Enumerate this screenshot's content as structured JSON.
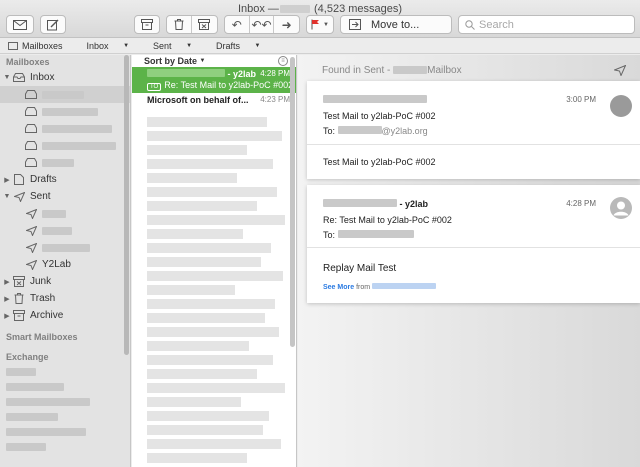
{
  "window": {
    "title": "Inbox",
    "count": "(4,523 messages)"
  },
  "toolbar": {
    "move_label": "Move to...",
    "search_placeholder": "Search"
  },
  "favorites": {
    "mailboxes": "Mailboxes",
    "inbox": "Inbox",
    "sent": "Sent",
    "drafts": "Drafts"
  },
  "sidebar": {
    "section_mailboxes": "Mailboxes",
    "inbox": "Inbox",
    "drafts": "Drafts",
    "sent": "Sent",
    "sent_child": "Y2Lab",
    "junk": "Junk",
    "trash": "Trash",
    "archive": "Archive",
    "section_smart": "Smart Mailboxes",
    "section_exchange": "Exchange"
  },
  "list": {
    "sort_label": "Sort by Date",
    "messages": [
      {
        "from": "- y2lab",
        "time": "4:28 PM",
        "badge": "TO",
        "subject": "Re: Test Mail to y2lab-PoC #002"
      },
      {
        "from": "Microsoft on behalf of...",
        "time": "4:23 PM"
      }
    ]
  },
  "reader": {
    "found_in": "Found in Sent -",
    "found_mailbox": "Mailbox",
    "card1": {
      "time": "3:00 PM",
      "subject": "Test Mail to y2lab-PoC #002",
      "to_label": "To:",
      "to_domain": "@y2lab.org",
      "body": "Test Mail to y2lab-PoC #002"
    },
    "card2": {
      "from": "- y2lab",
      "time": "4:28 PM",
      "subject": "Re: Test Mail to y2lab-PoC #002",
      "to_label": "To:",
      "body": "Replay Mail Test",
      "see_more": "See More",
      "see_from": "from"
    }
  },
  "colors": {
    "selected_green": "#5cb349",
    "link_blue": "#2a7ae2",
    "flag_red": "#e0312c"
  }
}
